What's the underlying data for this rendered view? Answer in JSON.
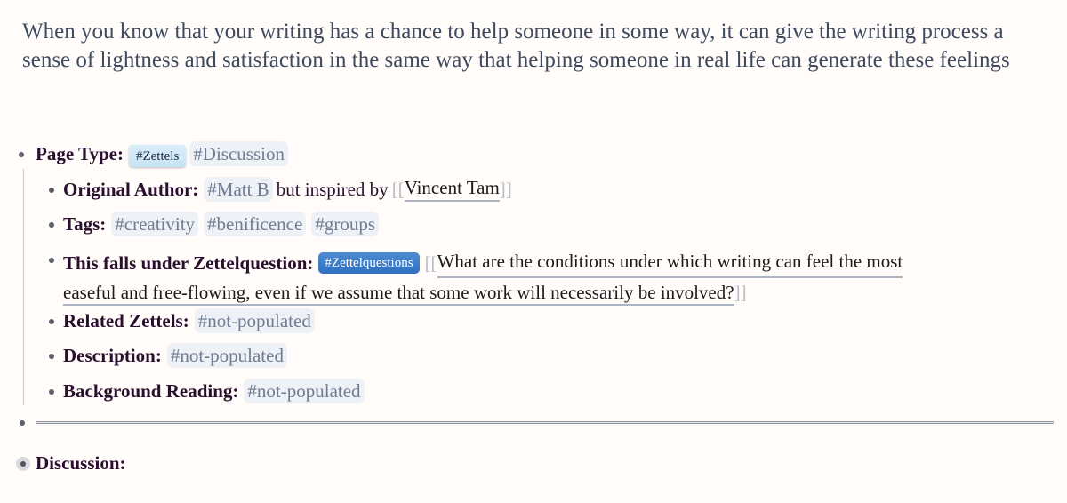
{
  "intro": "When you know that your writing has a chance to help someone in some way, it can give the writing process a sense of lightness and satisfaction in the same way that helping someone in real life can generate these feelings",
  "page_type": {
    "label": "Page Type:",
    "tags": [
      "#Zettels",
      "#Discussion"
    ]
  },
  "properties": {
    "original_author": {
      "label": "Original Author:",
      "tag": "#Matt B",
      "text": "but inspired by",
      "link_open": "[[",
      "link": "Vincent Tam",
      "link_close": "]]"
    },
    "tags": {
      "label": "Tags:",
      "values": [
        "#creativity",
        "#benificence",
        "#groups"
      ]
    },
    "zettelquestion": {
      "label": "This falls under Zettelquestion:",
      "tag": "#Zettelquestions",
      "link_open": "[[",
      "link_line1": "What are the conditions under which writing can feel the most",
      "link_line2": "easeful and free-flowing, even if we assume that some work will necessarily be involved?",
      "link_close": "]]"
    },
    "related_zettels": {
      "label": "Related Zettels:",
      "tag": "#not-populated"
    },
    "description": {
      "label": "Description:",
      "tag": "#not-populated"
    },
    "background_reading": {
      "label": "Background Reading:",
      "tag": "#not-populated"
    }
  },
  "discussion": {
    "label": "Discussion:"
  }
}
